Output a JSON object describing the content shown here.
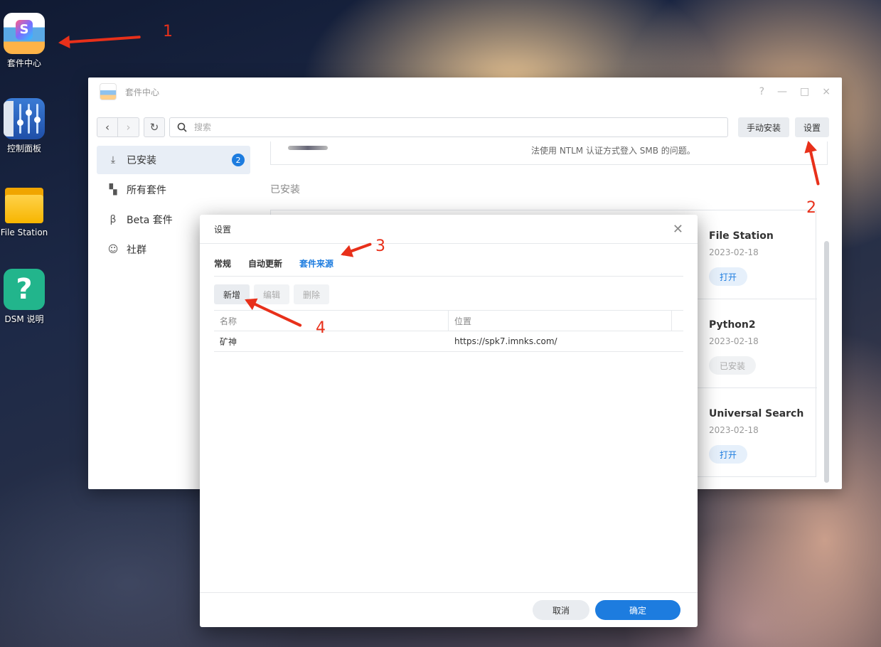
{
  "desktop": {
    "icons": [
      {
        "label": "套件中心"
      },
      {
        "label": "控制面板"
      },
      {
        "label": "File Station"
      },
      {
        "label": "DSM 说明"
      }
    ]
  },
  "window": {
    "title": "套件中心",
    "controls": {
      "help": "?",
      "minimize": "—",
      "maximize": "□",
      "close": "×"
    },
    "toolbar": {
      "search_placeholder": "搜索",
      "manual_install": "手动安装",
      "settings": "设置"
    },
    "sidebar": [
      {
        "label": "已安装",
        "badge": "2",
        "icon": "download-icon"
      },
      {
        "label": "所有套件",
        "icon": "grid-icon"
      },
      {
        "label": "Beta 套件",
        "icon": "beta-icon"
      },
      {
        "label": "社群",
        "icon": "community-icon"
      }
    ],
    "main": {
      "top_desc": "法使用 NTLM 认证方式登入 SMB 的问题。",
      "section_title": "已安装",
      "cards": [
        {
          "name": "File Station",
          "date": "2023-02-18",
          "button": "打开"
        },
        {
          "name": "Python2",
          "date": "2023-02-18",
          "button": "已安装"
        },
        {
          "name": "Universal Search",
          "date": "2023-02-18",
          "button": "打开"
        }
      ]
    }
  },
  "dialog": {
    "title": "设置",
    "tabs": [
      "常规",
      "自动更新",
      "套件来源"
    ],
    "actions": {
      "add": "新增",
      "edit": "编辑",
      "delete": "删除"
    },
    "grid": {
      "headers": [
        "名称",
        "位置"
      ],
      "rows": [
        {
          "name": "矿神",
          "location": "https://spk7.imnks.com/"
        }
      ]
    },
    "footer": {
      "cancel": "取消",
      "ok": "确定"
    }
  },
  "annotations": [
    "1",
    "2",
    "3",
    "4"
  ],
  "colors": {
    "accent": "#1d7cdf",
    "annotation": "#e8301a"
  }
}
